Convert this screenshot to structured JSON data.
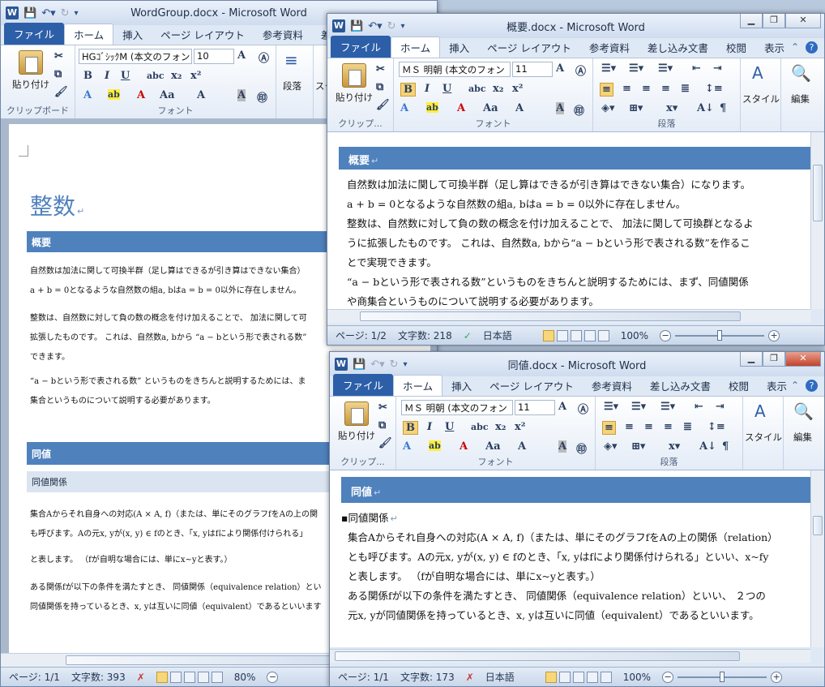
{
  "windows": {
    "group": {
      "title": "WordGroup.docx - Microsoft Word",
      "tabs": [
        "ファイル",
        "ホーム",
        "挿入",
        "ページ レイアウト",
        "参考資料",
        "差し込み文書"
      ],
      "font_name": "HGｺﾞｼｯｸM (本文のフォン",
      "font_size": "10",
      "clipboard_label": "クリップボード",
      "font_group_label": "フォント",
      "paste_label": "貼り付け",
      "paragraph_label": "段落",
      "style_label_partial": "スタ",
      "doc_title": "整数",
      "h_overview": "概要",
      "p1": "自然数は加法に関して可換半群（足し算はできるが引き算はできない集合）",
      "p2": "a + b = 0となるような自然数の組a, bはa = b = 0以外に存在しません。",
      "p3": "整数は、自然数に対して負の数の概念を付け加えることで、 加法に関して可",
      "p4": "拡張したものです。 これは、自然数a, bから “a − bという形で表される数”",
      "p5": "できます。",
      "p6": "“a − bという形で表される数” というものをきちんと説明するためには、ま",
      "p7": "集合というものについて説明する必要があります。",
      "h_equiv": "同値",
      "h_equiv_rel": "同値関係",
      "p8": "集合Aからそれ自身への対応(A × A, f)（または、単にそのグラフfをAの上の関",
      "p9": "も呼びます。Aの元x, yが(x, y) ∈ fのとき、「x, yはfにより関係付けられる」",
      "p10": "と表します。 （fが自明な場合には、単にx~yと表す。）",
      "p11": "ある関係fが以下の条件を満たすとき、 同値関係（equivalence relation）とい",
      "p12": "同値関係を持っているとき、x, yは互いに同値（equivalent）であるといいます",
      "status": {
        "page": "ページ: 1/1",
        "words": "文字数: 393",
        "zoom": "80%"
      }
    },
    "overview": {
      "title": "概要.docx - Microsoft Word",
      "tabs": [
        "ファイル",
        "ホーム",
        "挿入",
        "ページ レイアウト",
        "参考資料",
        "差し込み文書",
        "校閲",
        "表示"
      ],
      "font_name": "ＭＳ 明朝 (本文のフォン",
      "font_size": "11",
      "clipboard_label": "クリップ...",
      "font_group_label": "フォント",
      "paragraph_label": "段落",
      "paste_label": "貼り付け",
      "style_label": "スタイル",
      "edit_label": "編集",
      "heading": "概要",
      "l1": "自然数は加法に関して可換半群（足し算はできるが引き算はできない集合）になります。",
      "l2": "a + b = 0となるような自然数の組a, bはa = b = 0以外に存在しません。",
      "l3": "整数は、自然数に対して負の数の概念を付け加えることで、 加法に関して可換群となるよ",
      "l4": "うに拡張したものです。 これは、自然数a, bから“a − bという形で表される数”を作るこ",
      "l5": "とで実現できます。",
      "l6": "“a − bという形で表される数”というものをきちんと説明するためには、まず、同値関係",
      "l7": "や商集合というものについて説明する必要があります。",
      "status": {
        "page": "ページ: 1/2",
        "words": "文字数: 218",
        "lang": "日本語",
        "zoom": "100%"
      }
    },
    "equiv": {
      "title": "同値.docx - Microsoft Word",
      "tabs": [
        "ファイル",
        "ホーム",
        "挿入",
        "ページ レイアウト",
        "参考資料",
        "差し込み文書",
        "校閲",
        "表示"
      ],
      "font_name": "ＭＳ 明朝 (本文のフォン",
      "font_size": "11",
      "clipboard_label": "クリップ...",
      "font_group_label": "フォント",
      "paragraph_label": "段落",
      "paste_label": "貼り付け",
      "style_label": "スタイル",
      "edit_label": "編集",
      "heading": "同値",
      "sub": "同値関係",
      "l1": "集合Aからそれ自身への対応(A × A, f)（または、単にそのグラフfをAの上の関係（relation）",
      "l2": "とも呼びます。Aの元x, yが(x, y) ∈ fのとき、「x, yはfにより関係付けられる」といい、x~fy",
      "l3": "と表します。 （fが自明な場合には、単にx~yと表す。）",
      "l4": "ある関係fが以下の条件を満たすとき、 同値関係（equivalence relation）といい、 ２つの",
      "l5": "元x, yが同値関係を持っているとき、x, yは互いに同値（equivalent）であるといいます。",
      "status": {
        "page": "ページ: 1/1",
        "words": "文字数: 173",
        "lang": "日本語",
        "zoom": "100%"
      }
    }
  },
  "colors": {
    "heading_bar": "#4f81bd",
    "file_tab": "#2c5fa8",
    "title_blue": "#4f81bd"
  }
}
